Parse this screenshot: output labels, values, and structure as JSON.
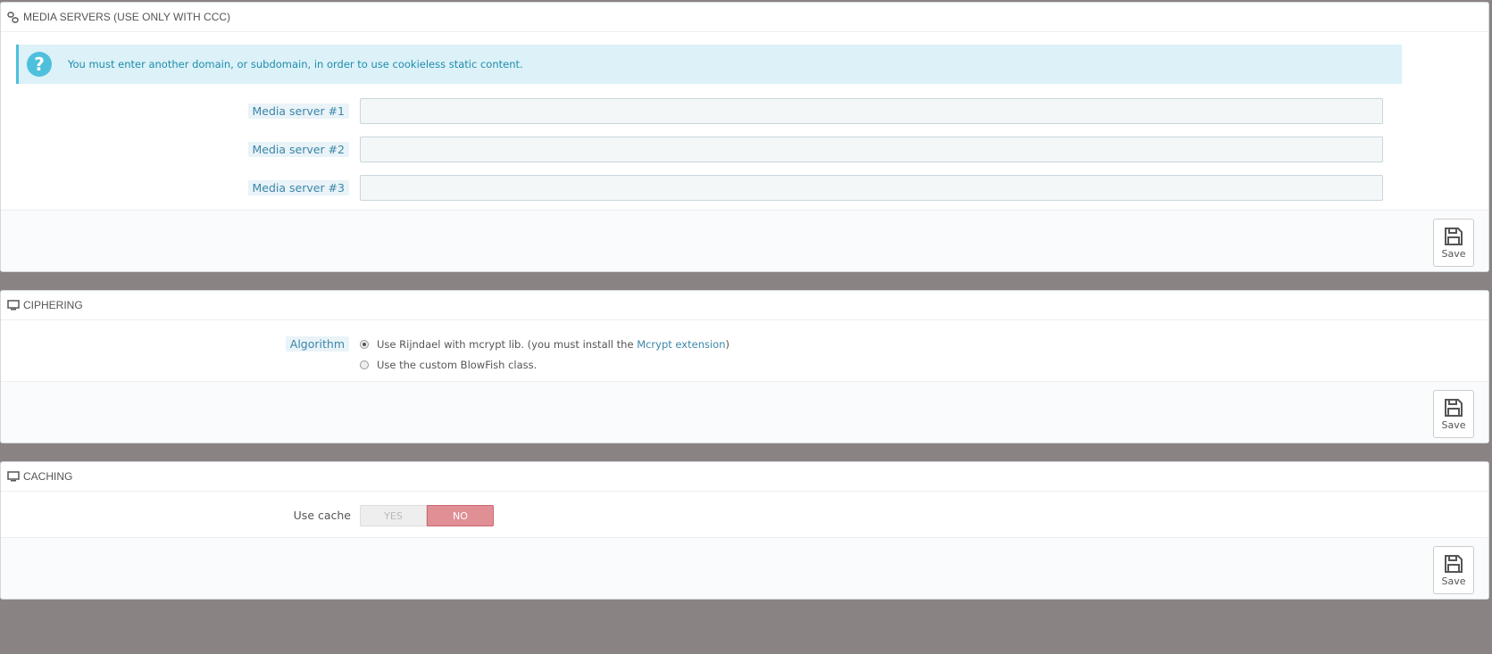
{
  "media_servers": {
    "title": "MEDIA SERVERS (USE ONLY WITH CCC)",
    "icon": "link-icon",
    "alert_text": "You must enter another domain, or subdomain, in order to use cookieless static content.",
    "fields": [
      {
        "label": "Media server #1",
        "value": ""
      },
      {
        "label": "Media server #2",
        "value": ""
      },
      {
        "label": "Media server #3",
        "value": ""
      }
    ],
    "save_label": "Save"
  },
  "ciphering": {
    "title": "CIPHERING",
    "icon": "monitor-icon",
    "algorithm_label": "Algorithm",
    "option1_text": "Use Rijndael with mcrypt lib. (you must install the ",
    "option1_link": "Mcrypt extension",
    "option1_suffix": ")",
    "option2_text": "Use the custom BlowFish class.",
    "selected": 1,
    "save_label": "Save"
  },
  "caching": {
    "title": "CACHING",
    "icon": "monitor-icon",
    "use_cache_label": "Use cache",
    "yes_label": "YES",
    "no_label": "NO",
    "value": "NO",
    "save_label": "Save"
  },
  "colors": {
    "page_bg": "#8a8384",
    "alert_bg": "#dcf1f8",
    "alert_text": "#1e8daa",
    "label_blue": "#3b86a8",
    "toggle_no": "#e08f95"
  }
}
